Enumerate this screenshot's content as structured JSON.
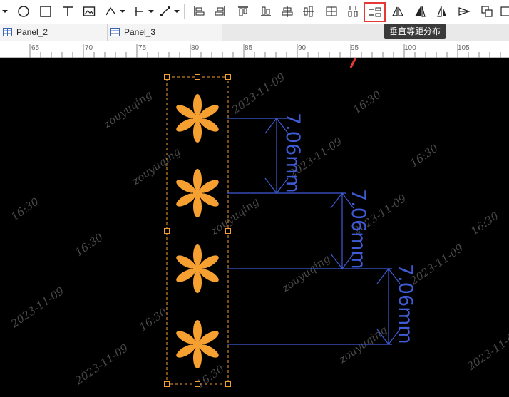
{
  "toolbar": {
    "items": [
      "dropdown-arrow",
      "circle",
      "rectangle",
      "text",
      "image",
      "polyline-tool",
      "line-tool",
      "measure-tool",
      "align-left",
      "align-right",
      "align-top",
      "align-bottom",
      "align-center-horizontal",
      "align-center-vertical",
      "distribute-grid",
      "distribute-horizontal-spacing",
      "distribute-vertical-spacing",
      "flip-horizontal",
      "flip-vertical",
      "mirror",
      "arrange",
      "group"
    ],
    "highlighted": "distribute-vertical-spacing",
    "tooltip": "垂直等距分布"
  },
  "tabs": [
    {
      "label": "Panel_2"
    },
    {
      "label": "Panel_3"
    }
  ],
  "ruler": {
    "labels": [
      "65",
      "70",
      "75",
      "80",
      "85",
      "90",
      "95",
      "100",
      "105"
    ]
  },
  "canvas": {
    "dimension_label": "7.06mm",
    "watermark": {
      "user": "zouyuqing",
      "date": "2023-11-09",
      "time": "16:30"
    },
    "colors": {
      "asterisk": "#f6a031",
      "dimension": "#3f5bd6",
      "selection": "#f6a031",
      "annotation": "#e53935",
      "background": "#000000"
    }
  }
}
